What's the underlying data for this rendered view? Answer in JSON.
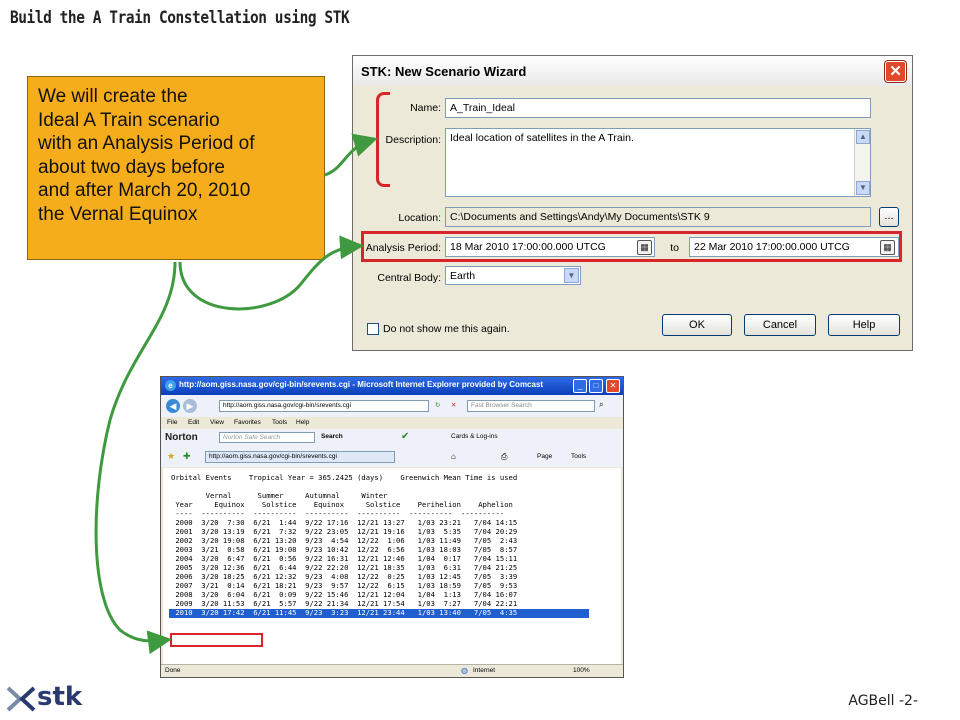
{
  "slide": {
    "title": "Build the A Train Constellation using STK",
    "footer": "AGBell -2-",
    "logo_text": "stk"
  },
  "callout": {
    "lines": [
      "We will create the",
      "Ideal A Train scenario",
      "with an Analysis Period of",
      "about two days before",
      "and after March 20, 2010",
      "the Vernal Equinox"
    ]
  },
  "wizard": {
    "title": "STK: New Scenario Wizard",
    "name_label": "Name:",
    "name_value": "A_Train_Ideal",
    "description_label": "Description:",
    "description_value": "Ideal location of satellites in the A Train.",
    "location_label": "Location:",
    "location_value": "C:\\Documents and Settings\\Andy\\My Documents\\STK 9",
    "browse_label": "...",
    "analysis_label": "Analysis Period:",
    "start_time": "18 Mar 2010 17:00:00.000 UTCG",
    "to_label": "to",
    "stop_time": "22 Mar 2010 17:00:00.000 UTCG",
    "central_body_label": "Central Body:",
    "central_body_value": "Earth",
    "dont_show_label": "Do not show me this again.",
    "ok_label": "OK",
    "cancel_label": "Cancel",
    "help_label": "Help"
  },
  "browser": {
    "title": "http://aom.giss.nasa.gov/cgi-bin/srevents.cgi - Microsoft Internet Explorer provided by Comcast",
    "address": "http://aom.giss.nasa.gov/cgi-bin/srevents.cgi",
    "search_placeholder": "Fast Browser Search",
    "menu": [
      "File",
      "Edit",
      "View",
      "Favorites",
      "Tools",
      "Help"
    ],
    "norton_label": "Norton",
    "norton_search_placeholder": "Norton Safe Search",
    "search_button": "Search",
    "cards_label": "Cards & Log-ins",
    "tab_address": "http://aom.giss.nasa.gov/cgi-bin/srevents.cgi",
    "page_menu": "Page",
    "tools_menu": "Tools",
    "status_left": "Done",
    "status_zone": "Internet",
    "zoom": "100%",
    "header_line": "Orbital Events    Tropical Year = 365.2425 (days)    Greenwich Mean Time is used",
    "col_header_1": "        Vernal      Summer     Autumnal     Winter",
    "col_header_2": " Year     Equinox    Solstice    Equinox     Solstice    Perihelion    Aphelion",
    "col_divider": " ----  ----------  ----------  ----------  ----------  ----------  ----------",
    "rows": [
      " 2000  3/20  7:30  6/21  1:44  9/22 17:16  12/21 13:27   1/03 23:21   7/04 14:15",
      " 2001  3/20 13:19  6/21  7:32  9/22 23:05  12/21 19:16   1/03  5:35   7/04 20:29",
      " 2002  3/20 19:08  6/21 13:20  9/23  4:54  12/22  1:06   1/03 11:49   7/05  2:43",
      " 2003  3/21  0:58  6/21 19:08  9/23 10:42  12/22  6:56   1/03 18:03   7/05  8:57",
      " 2004  3/20  6:47  6/21  0:56  9/22 16:31  12/21 12:46   1/04  0:17   7/04 15:11",
      " 2005  3/20 12:36  6/21  6:44  9/22 22:20  12/21 18:35   1/03  6:31   7/04 21:25",
      " 2006  3/20 18:25  6/21 12:32  9/23  4:08  12/22  0:25   1/03 12:45   7/05  3:39",
      " 2007  3/21  0:14  6/21 18:21  9/23  9:57  12/22  6:15   1/03 18:59   7/05  9:53",
      " 2008  3/20  6:04  6/21  0:09  9/22 15:46  12/21 12:04   1/04  1:13   7/04 16:07",
      " 2009  3/20 11:53  6/21  5:57  9/22 21:34  12/21 17:54   1/03  7:27   7/04 22:21",
      " 2010  3/20 17:42  6/21 11:45  9/23  3:23  12/21 23:44   1/03 13:40   7/05  4:35"
    ]
  },
  "colors": {
    "callout_bg": "#f6ad1c",
    "connector": "#3f9a3f",
    "highlight": "#d7262a",
    "selected_row": "#1f5fd0"
  }
}
